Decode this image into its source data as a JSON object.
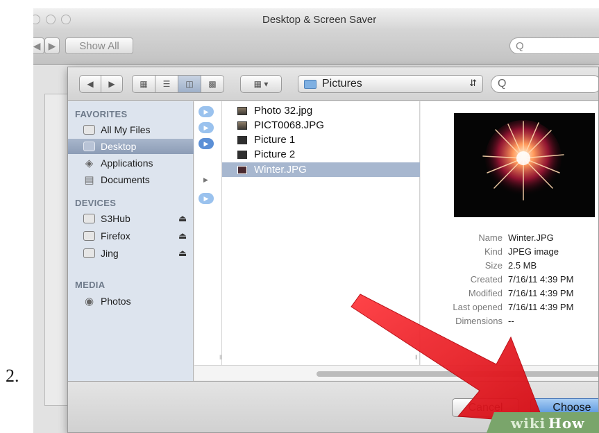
{
  "step_number": "2.",
  "window": {
    "title": "Desktop & Screen Saver",
    "show_all_label": "Show All",
    "search_glyph": "Q"
  },
  "open_dialog": {
    "location": "Pictures",
    "search_glyph": "Q",
    "sidebar": {
      "favorites_header": "FAVORITES",
      "favorites": [
        {
          "label": "All My Files",
          "icon": "all-files-icon",
          "selected": false
        },
        {
          "label": "Desktop",
          "icon": "desktop-folder-icon",
          "selected": true
        },
        {
          "label": "Applications",
          "icon": "applications-icon",
          "selected": false
        },
        {
          "label": "Documents",
          "icon": "documents-icon",
          "selected": false
        }
      ],
      "devices_header": "DEVICES",
      "devices": [
        {
          "label": "S3Hub",
          "icon": "disk-icon",
          "ejectable": true
        },
        {
          "label": "Firefox",
          "icon": "disk-icon",
          "ejectable": true
        },
        {
          "label": "Jing",
          "icon": "disk-icon",
          "ejectable": true
        }
      ],
      "media_header": "MEDIA",
      "media": [
        {
          "label": "Photos",
          "icon": "camera-icon"
        }
      ]
    },
    "files": [
      {
        "name": "Photo 32.jpg",
        "icon": "image-file-icon",
        "selected": false
      },
      {
        "name": "PICT0068.JPG",
        "icon": "image-file-icon",
        "selected": false
      },
      {
        "name": "Picture 1",
        "icon": "screenshot-file-icon",
        "selected": false
      },
      {
        "name": "Picture 2",
        "icon": "screenshot-file-icon",
        "selected": false
      },
      {
        "name": "Winter.JPG",
        "icon": "image-file-icon",
        "selected": true
      }
    ],
    "preview": {
      "image": "fireworks-preview",
      "info": [
        {
          "key": "Name",
          "value": "Winter.JPG"
        },
        {
          "key": "Kind",
          "value": "JPEG image"
        },
        {
          "key": "Size",
          "value": "2.5 MB"
        },
        {
          "key": "Created",
          "value": "7/16/11 4:39 PM"
        },
        {
          "key": "Modified",
          "value": "7/16/11 4:39 PM"
        },
        {
          "key": "Last opened",
          "value": "7/16/11 4:39 PM"
        },
        {
          "key": "Dimensions",
          "value": "--"
        }
      ]
    },
    "cancel_label": "Cancel",
    "choose_label": "Choose"
  },
  "watermark": {
    "wiki": "wiki",
    "how": "How"
  },
  "colors": {
    "annotation_arrow": "#e8141b",
    "selection": "#a7b7cf",
    "default_button": "#4f8fdc"
  }
}
